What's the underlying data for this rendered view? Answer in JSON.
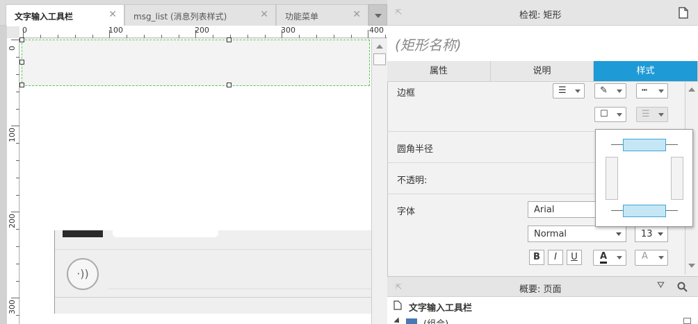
{
  "tabs": [
    {
      "label": "文字输入工具栏",
      "active": true,
      "close": "✕"
    },
    {
      "label": "msg_list (消息列表样式)",
      "active": false,
      "close": "✕"
    },
    {
      "label": "功能菜单",
      "active": false,
      "close": "✕"
    }
  ],
  "ruler": {
    "h_labels": [
      "0",
      "100",
      "200",
      "300",
      "400"
    ],
    "v_labels": [
      "0",
      "100",
      "200",
      "300"
    ]
  },
  "canvas": {
    "voice_icon": "·))"
  },
  "inspector": {
    "title": "检视: 矩形",
    "name_placeholder": "(矩形名称)",
    "tabs": [
      "属性",
      "说明",
      "样式"
    ],
    "active_tab": "样式"
  },
  "style": {
    "border_label": "边框",
    "radius_label": "圆角半径",
    "opacity_label": "不透明:",
    "font_label": "字体",
    "font_family": "Arial",
    "font_weight": "Normal",
    "font_size": "13",
    "bold": "B",
    "italic": "I",
    "underline": "U",
    "text_color_glyph": "A",
    "text_shadow_glyph": "A"
  },
  "outline": {
    "title": "概要: 页面",
    "page_name": "文字输入工具栏",
    "group_item": "(组合)"
  },
  "colors": {
    "accent": "#1e9ad6",
    "selection": "#4ccd4c"
  }
}
